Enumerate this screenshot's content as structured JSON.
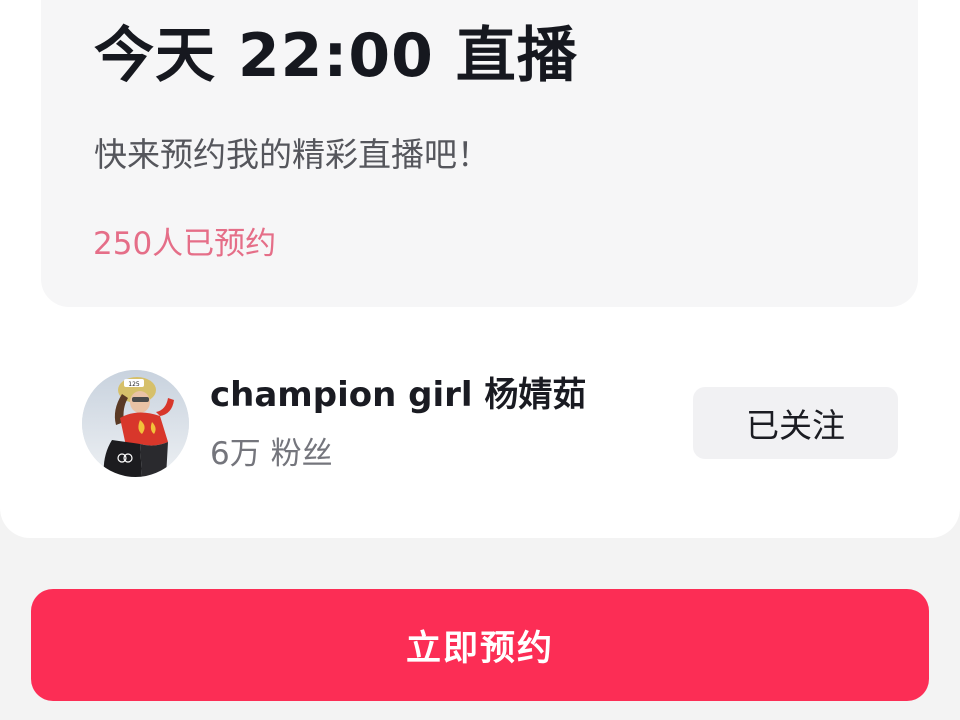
{
  "live_card": {
    "title": "今天 22:00 直播",
    "subtitle": "快来预约我的精彩直播吧！",
    "reserved_count": "250人已预约"
  },
  "author": {
    "name": "champion girl 杨婧茹",
    "fans": "6万 粉丝",
    "avatar_badge": "125",
    "follow_label": "已关注"
  },
  "actions": {
    "reserve_label": "立即预约"
  },
  "colors": {
    "primary": "#fc2d55",
    "reserved_text": "#e56e88",
    "card_bg": "#f6f6f7"
  },
  "icons": {
    "avatar": "athlete-photo"
  }
}
